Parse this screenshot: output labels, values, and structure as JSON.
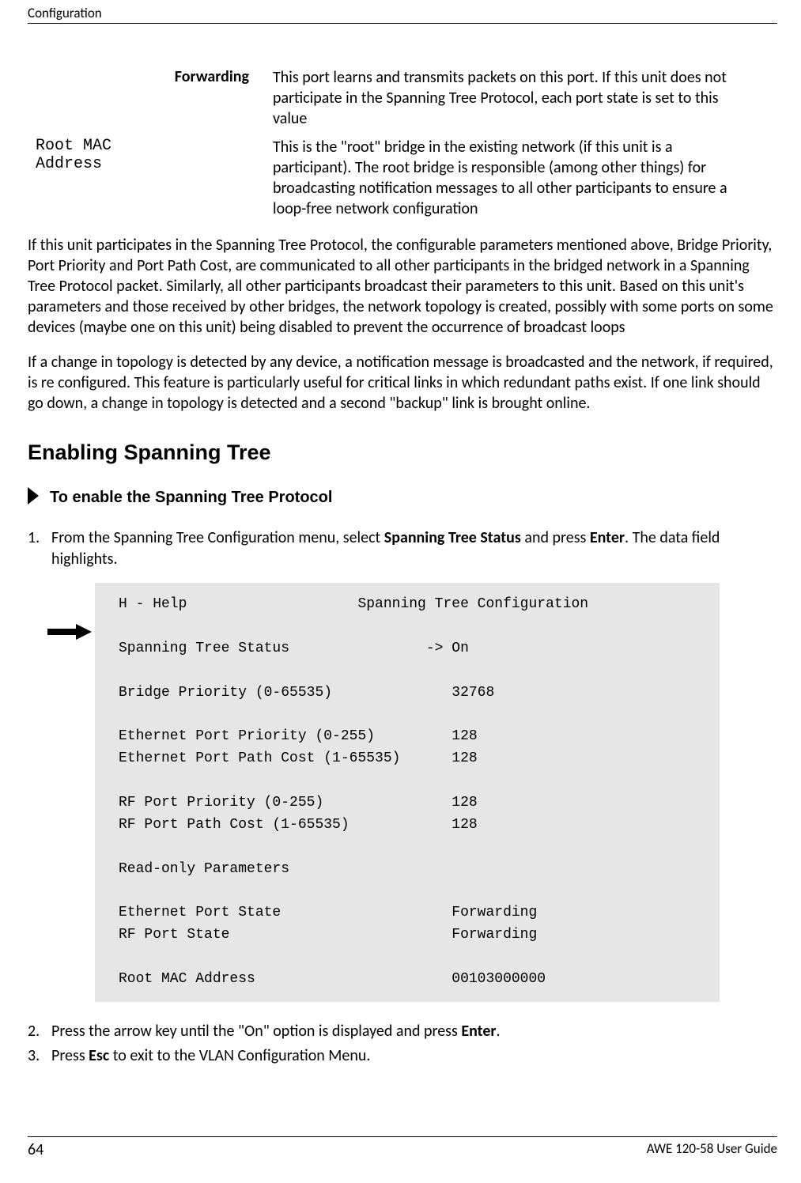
{
  "header": {
    "section": "Configuration"
  },
  "definitions": [
    {
      "term": "Forwarding",
      "termClass": "bold",
      "desc": "This port learns and transmits packets on this port. If this unit does not participate in the Spanning Tree Protocol, each port state is set to this value"
    },
    {
      "term": "Root MAC\nAddress",
      "termClass": "mono",
      "desc": "This is the \"root\" bridge in the existing network (if this unit is a participant). The root bridge is responsible (among other things) for broadcasting notification messages to all other participants to ensure a loop-free network configuration"
    }
  ],
  "paragraphs": {
    "p1": "If this unit participates in the Spanning Tree Protocol, the configurable parameters mentioned above, Bridge Priority, Port Priority and Port Path Cost, are communicated to all other participants in the bridged network in a Spanning Tree Protocol packet.    Similarly, all other participants broadcast their parameters to this unit. Based on this unit's parameters and those received by other bridges, the network topology is created, possibly with some ports on some devices (maybe one on this unit) being disabled to prevent the occurrence of broadcast loops",
    "p2": "If a change in topology is detected by any device, a notification message is broadcasted and the network, if required, is re configured. This feature is particularly useful for critical links in which redundant paths exist. If one link should go down, a change in topology is detected and a second \"backup\" link is brought online."
  },
  "section_heading": "Enabling Spanning Tree",
  "procedure_title": "To enable the Spanning Tree Protocol",
  "steps": {
    "s1_pre": "From the Spanning Tree Configuration menu, select ",
    "s1_bold1": "Spanning Tree Status",
    "s1_mid": " and press ",
    "s1_bold2": "Enter",
    "s1_post": ". The data field highlights.",
    "s2_pre": "Press the arrow key until the \"On\" option is displayed and press ",
    "s2_bold": "Enter",
    "s2_post": ".",
    "s3_pre": "Press ",
    "s3_bold": "Esc",
    "s3_post": " to exit to the VLAN Configuration Menu."
  },
  "terminal": {
    "title_left": "H - Help",
    "title_right": "Spanning Tree Configuration",
    "lines": [
      {
        "label": "Spanning Tree Status",
        "value": "-> On",
        "valcol": 36
      },
      {
        "blank": true
      },
      {
        "label": "Bridge Priority (0-65535)",
        "value": "32768",
        "valcol": 39
      },
      {
        "blank": true
      },
      {
        "label": "Ethernet Port Priority (0-255)",
        "value": "128",
        "valcol": 39
      },
      {
        "label": "Ethernet Port Path Cost (1-65535)",
        "value": "128",
        "valcol": 39
      },
      {
        "blank": true
      },
      {
        "label": "RF Port Priority (0-255)",
        "value": "128",
        "valcol": 39
      },
      {
        "label": "RF Port Path Cost (1-65535)",
        "value": "128",
        "valcol": 39
      },
      {
        "blank": true
      },
      {
        "label": "Read-only Parameters",
        "value": "",
        "valcol": 39
      },
      {
        "blank": true
      },
      {
        "label": "Ethernet Port State",
        "value": "Forwarding",
        "valcol": 39
      },
      {
        "label": "RF Port State",
        "value": "Forwarding",
        "valcol": 39
      },
      {
        "blank": true
      },
      {
        "label": "Root MAC Address",
        "value": "00103000000",
        "valcol": 39
      }
    ]
  },
  "footer": {
    "page": "64",
    "guide": "AWE 120-58 User Guide"
  }
}
